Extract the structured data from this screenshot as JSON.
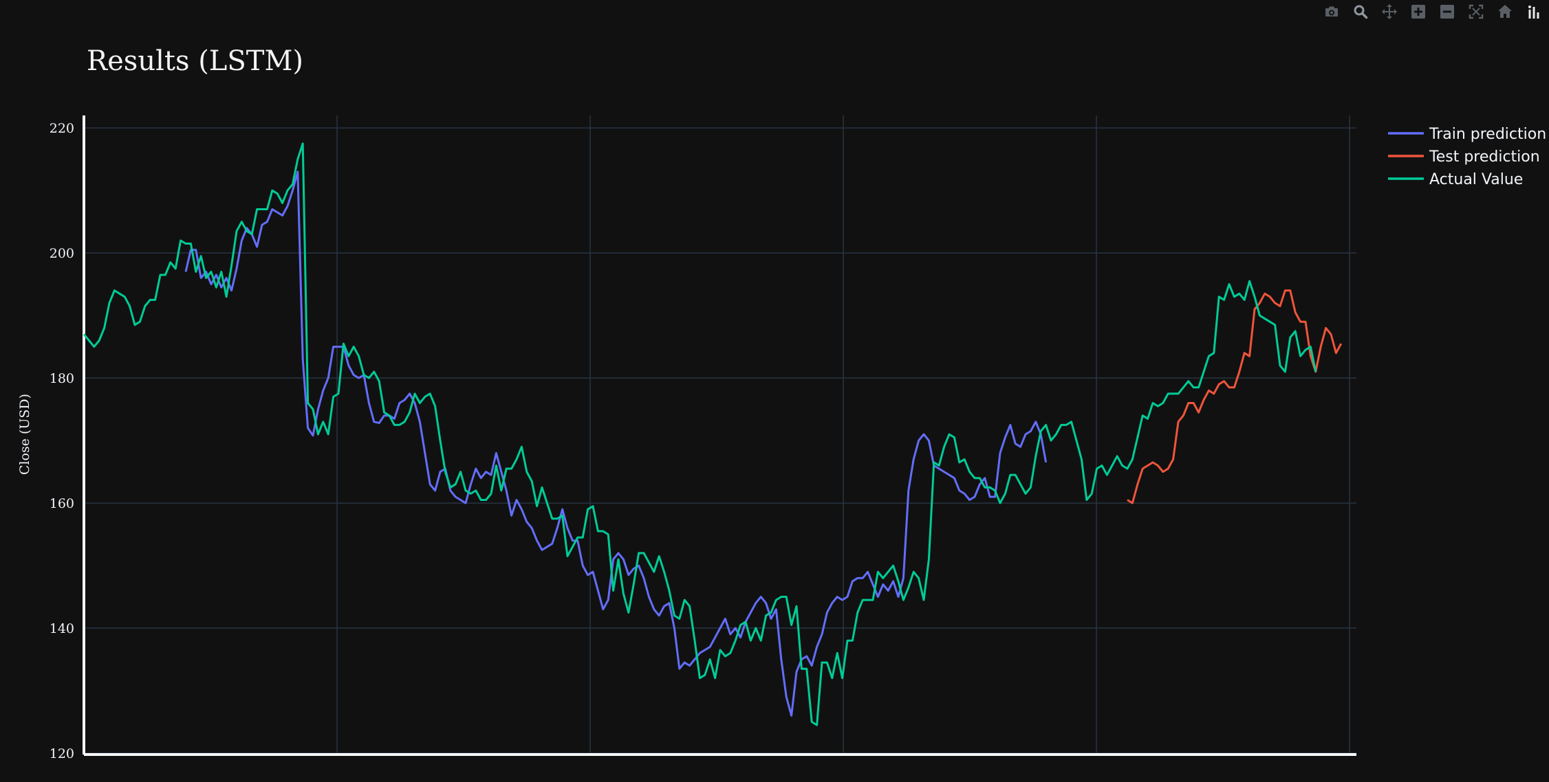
{
  "modebar": {
    "icons": [
      "camera-icon",
      "zoom-icon",
      "pan-icon",
      "zoom-in-icon",
      "zoom-out-icon",
      "autoscale-icon",
      "home-icon",
      "plotly-logo-icon"
    ]
  },
  "colors": {
    "background": "#111111",
    "grid": "#283442",
    "train": "#636efa",
    "test": "#ef553b",
    "actual": "#00cc96"
  },
  "chart_data": {
    "type": "line",
    "title": "Results (LSTM)",
    "xlabel": "",
    "ylabel": "Close (USD)",
    "ylim": [
      120,
      222
    ],
    "yticks": [
      120,
      140,
      160,
      180,
      200,
      220
    ],
    "xlim": [
      0,
      250
    ],
    "xtick_count": 6,
    "grid": true,
    "legend_position": "top-right",
    "series": [
      {
        "name": "Train prediction",
        "color": "#636efa",
        "start_index": 20,
        "values": [
          197.0,
          200.5,
          200.5,
          196.0,
          197.0,
          195.0,
          196.5,
          194.5,
          196.0,
          194.0,
          197.5,
          202.0,
          204.0,
          203.0,
          201.0,
          204.5,
          205.0,
          207.0,
          206.5,
          206.0,
          207.5,
          210.0,
          213.0,
          183.0,
          172.0,
          170.8,
          175.0,
          178.0,
          180.0,
          185.0,
          185.0,
          185.0,
          182.0,
          180.5,
          180.0,
          180.5,
          176.0,
          173.0,
          172.8,
          174.0,
          174.0,
          173.5,
          176.0,
          176.5,
          177.5,
          176.0,
          173.0,
          168.0,
          163.0,
          162.0,
          165.0,
          165.5,
          162.0,
          161.0,
          160.5,
          160.0,
          163.0,
          165.5,
          164.0,
          165.0,
          164.5,
          168.0,
          165.0,
          162.0,
          158.0,
          160.5,
          159.0,
          157.0,
          156.0,
          154.0,
          152.5,
          153.0,
          153.5,
          156.0,
          159.0,
          156.0,
          154.0,
          154.0,
          150.0,
          148.5,
          149.0,
          146.0,
          143.0,
          144.5,
          151.0,
          152.0,
          151.0,
          148.5,
          149.5,
          150.0,
          148.0,
          145.0,
          143.0,
          142.0,
          143.5,
          144.0,
          140.0,
          133.5,
          134.5,
          134.0,
          135.0,
          136.0,
          136.5,
          137.0,
          138.5,
          140.0,
          141.5,
          139.0,
          140.0,
          138.5,
          141.0,
          142.5,
          144.0,
          145.0,
          144.0,
          141.5,
          143.0,
          135.0,
          129.0,
          126.0,
          133.0,
          135.0,
          135.5,
          134.0,
          137.0,
          139.0,
          142.5,
          144.0,
          145.0,
          144.5,
          145.0,
          147.5,
          148.0,
          148.0,
          149.0,
          147.0,
          145.0,
          147.0,
          146.0,
          147.5,
          145.0,
          148.0,
          162.0,
          167.0,
          170.0,
          171.0,
          170.0,
          166.0,
          165.5,
          165.0,
          164.5,
          164.0,
          162.0,
          161.5,
          160.5,
          161.0,
          163.0,
          164.0,
          161.0,
          161.0,
          168.0,
          170.5,
          172.5,
          169.5,
          169.0,
          171.0,
          171.5,
          173.0,
          171.0,
          166.5
        ]
      },
      {
        "name": "Test prediction",
        "color": "#ef553b",
        "start_index": 205,
        "values": [
          160.5,
          160.0,
          163.0,
          165.5,
          166.0,
          166.5,
          166.0,
          165.0,
          165.5,
          167.0,
          173.0,
          174.0,
          176.0,
          176.0,
          174.5,
          176.5,
          178.0,
          177.5,
          179.0,
          179.5,
          178.5,
          178.5,
          181.0,
          184.0,
          183.5,
          191.0,
          192.0,
          193.5,
          193.0,
          192.0,
          191.5,
          194.0,
          194.0,
          190.5,
          189.0,
          189.0,
          183.5,
          181.0,
          185.0,
          188.0,
          187.0,
          184.0,
          185.5
        ]
      },
      {
        "name": "Actual Value",
        "color": "#00cc96",
        "start_index": 0,
        "values": [
          187.0,
          186.0,
          185.0,
          186.0,
          188.0,
          192.0,
          194.0,
          193.5,
          193.0,
          191.5,
          188.5,
          189.0,
          191.5,
          192.5,
          192.5,
          196.5,
          196.5,
          198.5,
          197.5,
          202.0,
          201.5,
          201.5,
          197.0,
          199.5,
          196.0,
          197.0,
          194.5,
          197.0,
          193.0,
          198.0,
          203.5,
          205.0,
          203.5,
          203.0,
          207.0,
          207.0,
          207.0,
          210.0,
          209.5,
          208.0,
          210.0,
          211.0,
          215.0,
          217.5,
          176.0,
          175.0,
          171.0,
          173.0,
          171.0,
          177.0,
          177.5,
          185.5,
          183.5,
          185.0,
          183.5,
          180.5,
          180.0,
          181.0,
          179.5,
          174.5,
          174.0,
          172.5,
          172.5,
          173.0,
          174.5,
          177.5,
          176.0,
          177.0,
          177.5,
          175.5,
          170.0,
          165.0,
          162.5,
          163.0,
          165.0,
          162.0,
          161.5,
          162.0,
          160.5,
          160.5,
          161.5,
          166.0,
          162.0,
          165.5,
          165.5,
          167.0,
          169.0,
          165.0,
          163.5,
          159.5,
          162.5,
          160.0,
          157.5,
          157.5,
          158.0,
          151.5,
          153.0,
          154.5,
          154.5,
          159.0,
          159.5,
          155.5,
          155.5,
          155.0,
          146.0,
          151.0,
          145.5,
          142.5,
          147.0,
          152.0,
          152.0,
          150.5,
          149.0,
          151.5,
          149.0,
          146.0,
          142.0,
          141.5,
          144.5,
          143.5,
          138.0,
          132.0,
          132.5,
          135.0,
          132.0,
          136.5,
          135.5,
          136.0,
          138.0,
          140.5,
          141.0,
          138.0,
          140.0,
          138.0,
          142.0,
          142.5,
          144.5,
          145.0,
          145.0,
          140.5,
          143.5,
          133.5,
          133.5,
          125.0,
          124.5,
          134.5,
          134.5,
          132.0,
          136.0,
          132.0,
          138.0,
          138.0,
          142.5,
          144.5,
          144.5,
          144.5,
          149.0,
          148.0,
          149.0,
          150.0,
          147.5,
          144.5,
          146.5,
          149.0,
          148.0,
          144.5,
          151.0,
          166.5,
          166.0,
          169.0,
          171.0,
          170.5,
          166.5,
          167.0,
          165.0,
          164.0,
          164.0,
          162.5,
          162.5,
          162.0,
          160.0,
          161.5,
          164.5,
          164.5,
          163.0,
          161.5,
          162.5,
          167.5,
          171.5,
          172.5,
          170.0,
          171.0,
          172.5,
          172.5,
          173.0,
          170.0,
          167.0,
          160.5,
          161.5,
          165.5,
          166.0,
          164.5,
          166.0,
          167.5,
          166.0,
          165.5,
          167.0,
          170.5,
          174.0,
          173.5,
          176.0,
          175.5,
          176.0,
          177.5,
          177.5,
          177.5,
          178.5,
          179.5,
          178.5,
          178.5,
          181.0,
          183.5,
          184.0,
          193.0,
          192.5,
          195.0,
          193.0,
          193.5,
          192.5,
          195.5,
          193.0,
          190.0,
          189.5,
          189.0,
          188.5,
          182.0,
          181.0,
          186.5,
          187.5,
          183.5,
          184.5,
          185.0,
          181.0
        ]
      }
    ]
  }
}
